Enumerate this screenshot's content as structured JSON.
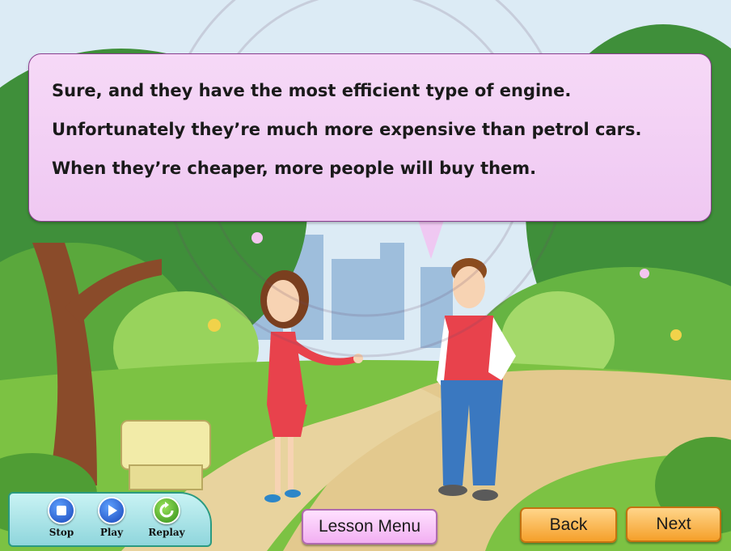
{
  "dialogue": {
    "lines": [
      "Sure, and they have the most efficient type of engine.",
      "Unfortunately they’re much more expensive than petrol cars.",
      "When they’re cheaper, more people will buy them."
    ]
  },
  "controls": {
    "stop_label": "Stop",
    "play_label": "Play",
    "replay_label": "Replay"
  },
  "navigation": {
    "lesson_menu_label": "Lesson Menu",
    "back_label": "Back",
    "next_label": "Next"
  },
  "colors": {
    "bubble": "#efc8f2",
    "sky": "#dcebf5",
    "grass": "#7cc243",
    "path": "#e3c98e",
    "nav_orange": "#f5a02a"
  }
}
